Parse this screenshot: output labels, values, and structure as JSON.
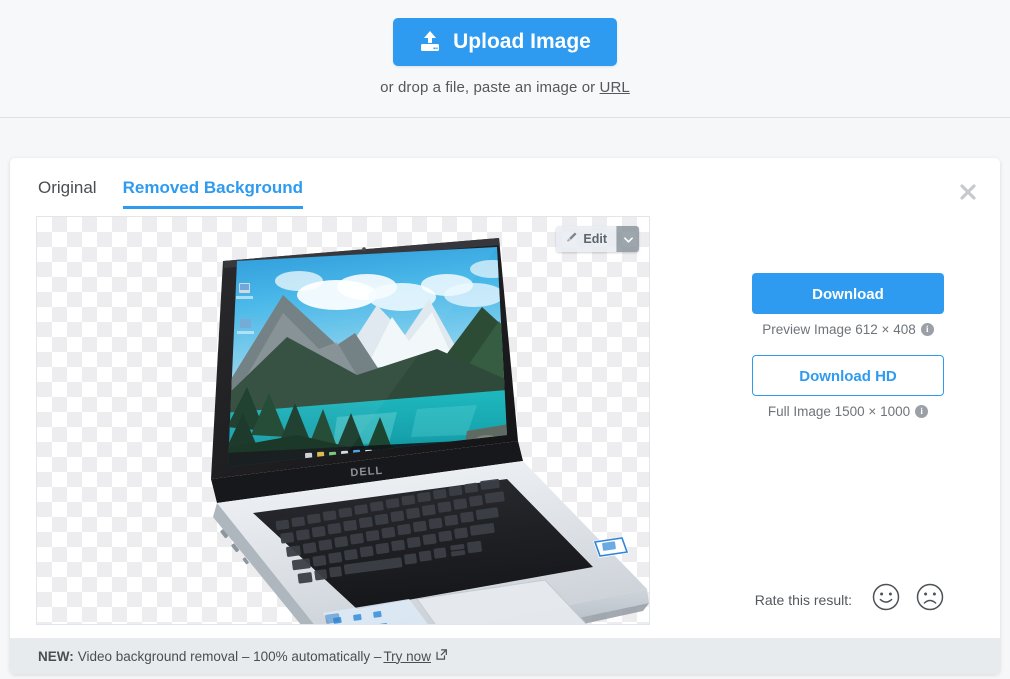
{
  "header": {
    "upload_button_label": "Upload Image",
    "upload_icon": "upload-tray-icon",
    "drop_text_prefix": "or drop a file, paste an image or ",
    "url_link_label": "URL"
  },
  "card": {
    "tabs": [
      {
        "label": "Original",
        "active": false
      },
      {
        "label": "Removed Background",
        "active": true
      }
    ],
    "close_icon": "close-icon"
  },
  "preview": {
    "edit_button_label": "Edit",
    "edit_icon": "brush-icon",
    "edit_caret_icon": "chevron-down-icon",
    "transparency_pattern": "checkerboard",
    "subject": "Dell laptop with mountain lake desktop wallpaper"
  },
  "actions": {
    "download_label": "Download",
    "download_caption": "Preview Image 612 × 408",
    "download_hd_label": "Download HD",
    "download_hd_caption": "Full Image 1500 × 1000",
    "info_icon": "info-icon",
    "info_glyph": "i"
  },
  "rating": {
    "label": "Rate this result:",
    "positive_icon": "smiley-happy-icon",
    "negative_icon": "smiley-sad-icon"
  },
  "footer": {
    "badge": "NEW:",
    "text": "Video background removal – 100% automatically –",
    "link_label": "Try now",
    "external_icon": "external-link-icon"
  },
  "colors": {
    "accent": "#2e9bf0",
    "page_bg": "#f6f7f9",
    "card_bg": "#ffffff",
    "footer_bg": "#e8ebed",
    "text": "#4a4e52",
    "muted_text": "#6e7479"
  }
}
